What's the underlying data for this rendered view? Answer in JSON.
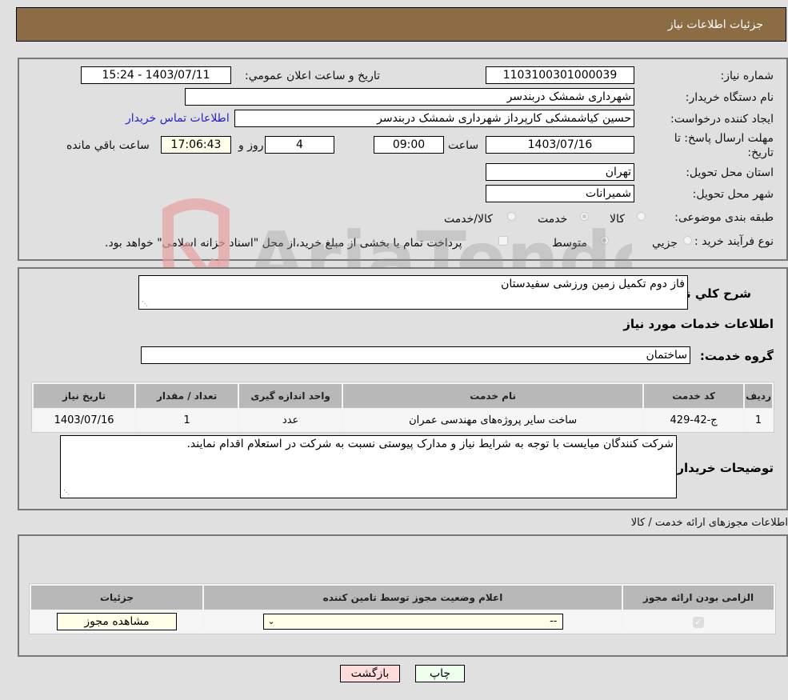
{
  "header": {
    "title": "جزئیات اطلاعات نیاز"
  },
  "form": {
    "need_number_label": "شماره نیاز:",
    "need_number": "1103100301000039",
    "announce_label": "تاریخ و ساعت اعلان عمومي:",
    "announce_value": "1403/07/11 - 15:24",
    "buyer_org_label": "نام دستگاه خریدار:",
    "buyer_org": "شهرداری شمشک دربندسر",
    "creator_label": "ایجاد کننده درخواست:",
    "creator": "حسین کیاشمشکی کارپرداز شهرداری شمشک دربندسر",
    "contact_link": "اطلاعات تماس خریدار",
    "deadline_label_1": "مهلت ارسال پاسخ: تا",
    "deadline_label_2": "تاریخ:",
    "deadline_date": "1403/07/16",
    "time_label": "ساعت",
    "deadline_time": "09:00",
    "days": "4",
    "days_label": "روز و",
    "remaining_time": "17:06:43",
    "remaining_label": "ساعت باقي مانده",
    "province_label": "استان محل تحویل:",
    "province": "تهران",
    "city_label": "شهر محل تحویل:",
    "city": "شمیرانات",
    "category_label": "طبقه بندی موضوعی:",
    "category_options": [
      "کالا",
      "خدمت",
      "کالا/خدمت"
    ],
    "category_selected": "خدمت",
    "process_label": "نوع فرآیند خرید :",
    "process_options": [
      "جزيي",
      "متوسط"
    ],
    "process_selected": "متوسط",
    "treasury_note": "پرداخت تمام یا بخشی از مبلغ خرید،از محل \"اسناد خزانه اسلامی\" خواهد بود."
  },
  "details": {
    "summary_label": "شرح کلي نیاز:",
    "summary": "فاز دوم تکمیل زمین ورزشی سفیدستان",
    "services_title": "اطلاعات خدمات مورد نیاز",
    "service_group_label": "گروه خدمت:",
    "service_group": "ساختمان",
    "table": {
      "headers": [
        "ردیف",
        "کد خدمت",
        "نام خدمت",
        "واحد اندازه گیری",
        "تعداد / مقدار",
        "تاریخ نیاز"
      ],
      "rows": [
        [
          "1",
          "ج-42-429",
          "ساخت سایر پروژه‌های مهندسی عمران",
          "عدد",
          "1",
          "1403/07/16"
        ]
      ]
    },
    "buyer_notes_label": "توضیحات خریدار:",
    "buyer_notes": "شرکت کنندگان میایست با توجه به شرایط نیاز و مدارک پیوستی نسبت به شرکت در استعلام اقدام نمایند."
  },
  "permits": {
    "title": "اطلاعات مجوزهای ارائه خدمت / کالا",
    "headers": [
      "الزامی بودن ارائه مجوز",
      "اعلام وضعیت مجوز توسط تامین کننده",
      "جزئیات"
    ],
    "required_checked": true,
    "status_select": "--",
    "view_button": "مشاهده مجوز"
  },
  "actions": {
    "print": "چاپ",
    "back": "بازگشت"
  },
  "watermark": {
    "text": "AriaTender.neT"
  }
}
